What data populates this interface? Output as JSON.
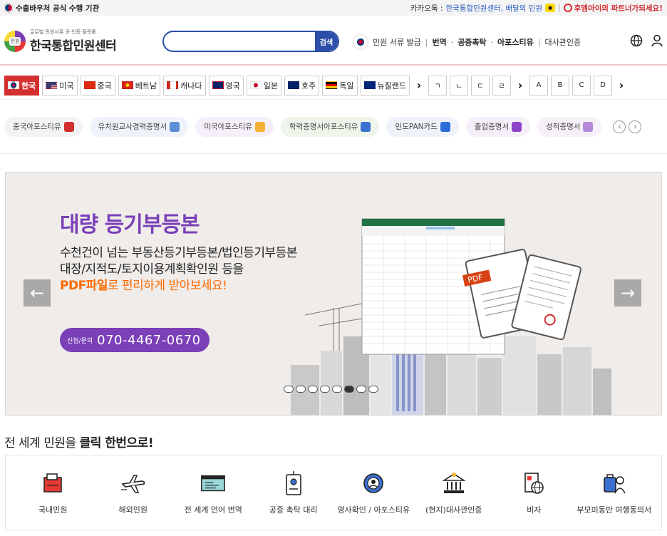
{
  "topbar": {
    "agency": "수출바우처 공식 수행 기관",
    "kakao_label": "카카오톡 :",
    "kakao_value": "한국통합민원센터, 배달의 민원",
    "partner": "후엠아이의 파트너가되세요!"
  },
  "header": {
    "logo_sub": "글로벌 민원서류 공·인증 플랫폼",
    "logo_main": "한국통합민원센터",
    "search_placeholder": "",
    "search_button": "검색",
    "nav": {
      "issue": "민원 서류 발급",
      "translate": "번역",
      "notary": "공증촉탁",
      "apostille": "아포스티유",
      "embassy": "대사관인증"
    }
  },
  "countries": [
    {
      "label": "한국",
      "flag": "kr",
      "active": true
    },
    {
      "label": "미국",
      "flag": "us"
    },
    {
      "label": "중국",
      "flag": "cn"
    },
    {
      "label": "베트남",
      "flag": "vn"
    },
    {
      "label": "캐나다",
      "flag": "ca"
    },
    {
      "label": "영국",
      "flag": "uk"
    },
    {
      "label": "일본",
      "flag": "jp"
    },
    {
      "label": "호주",
      "flag": "au"
    },
    {
      "label": "독일",
      "flag": "de"
    },
    {
      "label": "뉴질랜드",
      "flag": "nz"
    }
  ],
  "korean_letters": [
    "ㄱ",
    "ㄴ",
    "ㄷ",
    "ㄹ"
  ],
  "latin_letters": [
    "A",
    "B",
    "C",
    "D"
  ],
  "chips": [
    {
      "label": "중국아포스티유",
      "bg": "#f1f3f5",
      "icon": "#d32f2f"
    },
    {
      "label": "유치원교사경력증명서",
      "bg": "#eef3fa",
      "icon": "#5d8fd6"
    },
    {
      "label": "미국아포스티유",
      "bg": "#f5eff9",
      "icon": "#f2b233"
    },
    {
      "label": "학력증명서아포스티유",
      "bg": "#eef5ea",
      "icon": "#3b6fd1"
    },
    {
      "label": "인도PAN카드",
      "bg": "#eef3fa",
      "icon": "#2b6cd8"
    },
    {
      "label": "졸업증명서",
      "bg": "#f5eff9",
      "icon": "#8e44c9"
    },
    {
      "label": "성적증명서",
      "bg": "#f6f0f8",
      "icon": "#b58ad8"
    }
  ],
  "banner": {
    "title": "대량 등기부등본",
    "line1": "수천건이 넘는 부동산등기부등본/법인등기부등본",
    "line2": "대장/지적도/토지이용계획확인원 등을",
    "line3_highlight": "PDF파일",
    "line3_rest": "로 편리하게 받아보세요!",
    "phone_label": "신청/문의",
    "phone": "070-4467-0670",
    "pdf_label": "PDF",
    "slide_count": 8,
    "active_slide": 5
  },
  "section": {
    "title_prefix": "전 세계 민원을",
    "title_bold": "클릭 한번으로!"
  },
  "services": [
    {
      "label": "국내민원",
      "icon": "folder-icon"
    },
    {
      "label": "해외민원",
      "icon": "airplane-icon"
    },
    {
      "label": "전 세계 언어 번역",
      "icon": "translation-icon"
    },
    {
      "label": "공증 촉탁 대리",
      "icon": "id-card-icon"
    },
    {
      "label": "영사확인 / 아포스티유",
      "icon": "gear-person-icon"
    },
    {
      "label": "(현지)대사관인증",
      "icon": "embassy-icon"
    },
    {
      "label": "비자",
      "icon": "visa-icon"
    },
    {
      "label": "부모미동반 여행동의서",
      "icon": "traveler-icon"
    }
  ]
}
